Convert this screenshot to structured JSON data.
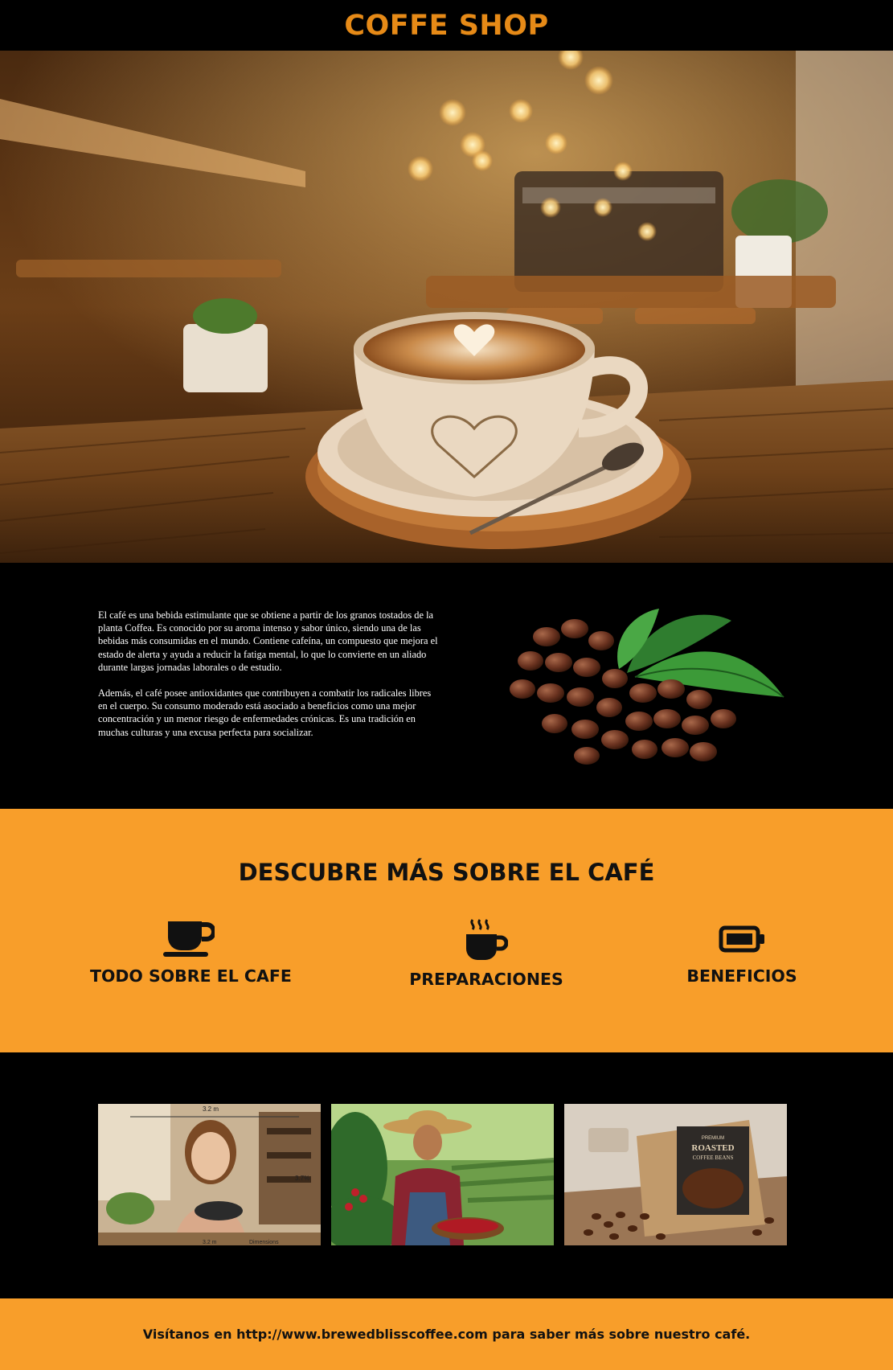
{
  "header": {
    "title": "COFFE SHOP"
  },
  "intro": {
    "paragraphs": [
      "El café es una bebida estimulante que se obtiene a partir de los granos tostados de la planta Coffea. Es conocido por su aroma intenso y sabor único, siendo una de las bebidas más consumidas en el mundo. Contiene cafeína, un compuesto que mejora el estado de alerta y ayuda a reducir la fatiga mental, lo que lo convierte en un aliado durante largas jornadas laborales o de estudio.",
      "Además, el café posee antioxidantes que contribuyen a combatir los radicales libres en el cuerpo. Su consumo moderado está asociado a beneficios como una mejor concentración y un menor riesgo de enfermedades crónicas. Es una tradición en muchas culturas y una excusa perfecta para socializar."
    ]
  },
  "discover": {
    "title": "DESCUBRE MÁS SOBRE EL CAFÉ",
    "features": [
      {
        "label": "TODO SOBRE EL CAFE",
        "icon": "coffee-cup-saucer-icon"
      },
      {
        "label": "PREPARACIONES",
        "icon": "hot-coffee-mug-icon"
      },
      {
        "label": "BENEFICIOS",
        "icon": "battery-full-icon"
      }
    ]
  },
  "gallery": {
    "image1": {
      "top_label": "3.2 m",
      "bottom_label": "3.2 m",
      "side_label": "3.7%",
      "corner_label": "Dimensions"
    },
    "image3": {
      "bag_line1": "PREMIUM",
      "bag_line2": "ROASTED",
      "bag_line3": "COFFEE BEANS"
    }
  },
  "footer": {
    "text": "Visítanos en http://www.brewedblisscoffee.com para saber más sobre nuestro café."
  },
  "colors": {
    "accent": "#e68a17",
    "orange": "#f89e2a",
    "black": "#000000"
  }
}
